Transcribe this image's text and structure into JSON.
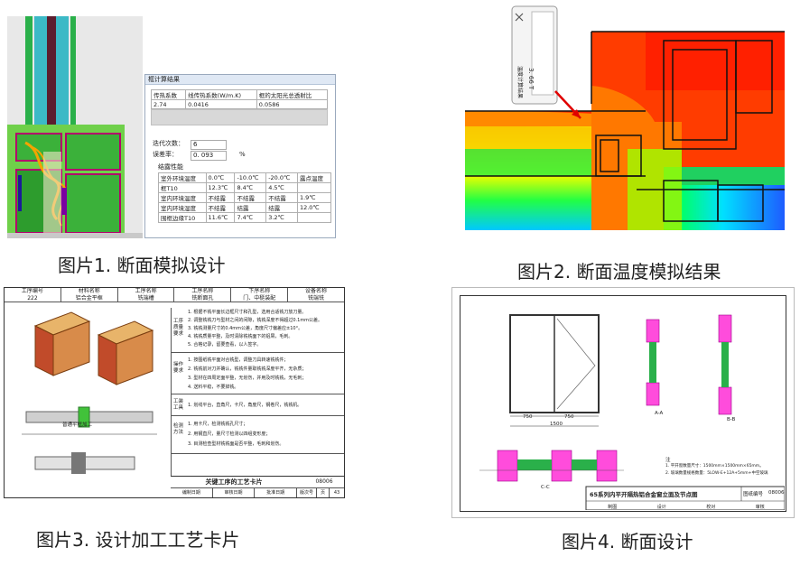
{
  "captions": {
    "c1": "图片1. 断面模拟设计",
    "c2": "图片2. 断面温度模拟结果",
    "c3": "图片3. 设计加工工艺卡片",
    "c4": "图片4. 断面设计"
  },
  "dialog": {
    "title": "框计算结果",
    "headers": [
      "传热系数",
      "线传热系数(W/m.K)",
      "框的太阳光总透射比"
    ],
    "values": [
      "2.74",
      "0.0416",
      "0.0586"
    ],
    "iter_label": "迭代次数：",
    "iter_value": "6",
    "err_label": "误差率：",
    "err_value": "0. 093",
    "err_unit": "%",
    "cond_label": "结露性能",
    "cond_headers": [
      "室外环境温度",
      "0.0℃",
      "-10.0℃",
      "-20.0℃",
      "露点温度"
    ],
    "cond_rows": [
      [
        "框T10",
        "12.3℃",
        "8.4℃",
        "4.5℃",
        ""
      ],
      [
        "室内环境温度",
        "不结露",
        "不结露",
        "不结露",
        "1.9℃"
      ],
      [
        "室内环境湿度",
        "不结露",
        "结露",
        "结露",
        "12.0℃"
      ],
      [
        "围框边缘T10",
        "11.6℃",
        "7.4℃",
        "3.2℃",
        ""
      ]
    ]
  },
  "temp_tooltip": {
    "value": "3. 66 T",
    "label": "温度计算结果"
  },
  "card": {
    "header_cells": [
      "工序编号",
      "材料名称",
      "工序名称",
      "工序名称",
      "下序名称",
      "设备名称"
    ],
    "header_values": [
      "222",
      "铝合金平框",
      "铣端槽",
      "铣断面孔",
      "门、中梃装配",
      "铣端铣"
    ],
    "sections": [
      {
        "label": "工序质量要求",
        "lines": [
          "1. 根据不铣平面长边框尺寸和孔型，选用合适铣刀放刀量。",
          "2. 调整铣铣刀与型材之间的间隙，铣铣深度不得超过0.1mm公差。",
          "3. 铣铣测量尺寸的0.4mm公差，角度尺寸偏差应±10°。",
          "4. 铣铣质量平整，及时清除铣铣面下的铝屑，毛刺。",
          "5. 合格记录，留要查看，以人签字。"
        ]
      },
      {
        "label": "操作要求",
        "lines": [
          "1. 按图纸铣平面对合铣型，调整刀具转速铣铣件；",
          "2. 铣铣前对刀并确认，铣铣件量取铣铣深度平齐，无杂质；",
          "3. 型材在四周定面平整，无划伤，并用及时铣铣，无毛刺；",
          "4. 送料平稳，不要掉铣。"
        ]
      },
      {
        "label": "工装工具",
        "lines": [
          "1. 划线平台，直角尺，卡尺，角度尺，钢卷尺，铣铣机。"
        ]
      },
      {
        "label": "检测方法",
        "lines": [
          "1. 用卡尺，检测铣铣孔尺寸；",
          "2. 用钢直尺，量尺寸检测以四组变形度；",
          "3. 目测检查型材铣铣面是否平整，毛刺和划伤。"
        ]
      }
    ],
    "figure_label": "普通平框加工",
    "footer_title": "关键工序的工艺卡片",
    "footer_code": "08006",
    "footer_cells": [
      "编制日期",
      "审核日期",
      "批准日期"
    ],
    "footer_right": [
      "版次号",
      "页",
      "43"
    ]
  },
  "drawing": {
    "dims_top": [
      "750",
      "750"
    ],
    "dim_total": "1500",
    "section_labels": [
      "A-A",
      "B-B",
      "C-C"
    ],
    "notes": [
      "注",
      "1. 平开窗数量尺寸：1500mm×1500mm×65mm。",
      "2. 玻璃数量规格数量：5LOW-E+12A+5mm+中空玻璃"
    ],
    "title": "65系列内平开隔热铝合金窗立面及节点图",
    "code_label": "图纸编号",
    "code_value": "08006",
    "sign_cells": [
      "制图",
      "设计",
      "校对",
      "审核"
    ]
  }
}
